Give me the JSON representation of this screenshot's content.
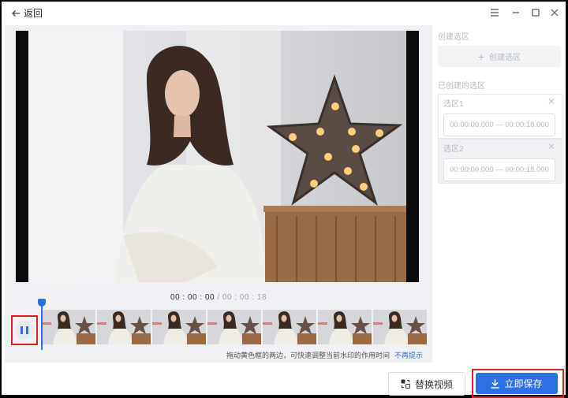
{
  "titlebar": {
    "back_label": "返回"
  },
  "player": {
    "current_time": "00 : 00 : 00",
    "separator": " / ",
    "total_time": "00 : 00 : 18"
  },
  "hint": {
    "text": "拖动黄色框的两边，可快速调整当前水印的作用时间",
    "link": "不再提示"
  },
  "sidebar": {
    "create_section_label": "创建选区",
    "create_button_label": "创建选区",
    "created_section_label": "已创建的选区",
    "selections": [
      {
        "name": "选区1",
        "range": "00:00:00.000 — 00:00:18.000"
      },
      {
        "name": "选区2",
        "range": "00:00:00.000 — 00:00:18.000"
      }
    ]
  },
  "footer": {
    "replace_label": "替换视频",
    "save_label": "立即保存"
  },
  "colors": {
    "accent": "#2f6fe4",
    "highlight_border": "#e02020"
  },
  "icons": [
    "back-arrow-icon",
    "menu-icon",
    "minimize-icon",
    "maximize-icon",
    "close-icon",
    "pause-icon",
    "plus-icon",
    "swap-video-icon",
    "download-icon"
  ]
}
